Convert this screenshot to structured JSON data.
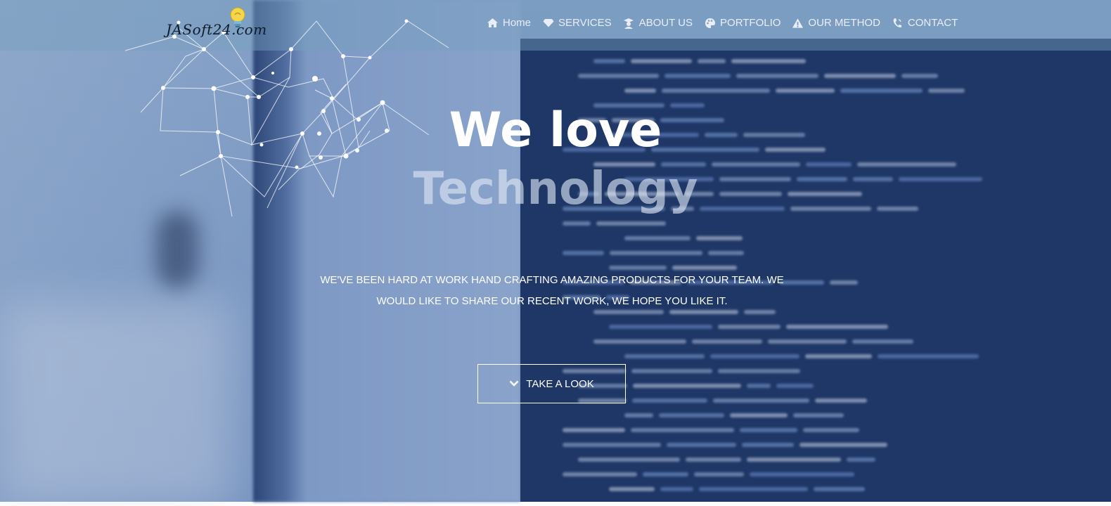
{
  "brand": {
    "logo_text": "JASoft24.com"
  },
  "nav": {
    "items": [
      {
        "label": "Home",
        "icon": "home-icon"
      },
      {
        "label": "SERVICES",
        "icon": "diamond-icon"
      },
      {
        "label": "ABOUT US",
        "icon": "graduate-icon"
      },
      {
        "label": "PORTFOLIO",
        "icon": "palette-icon"
      },
      {
        "label": "OUR METHOD",
        "icon": "triangle-icon"
      },
      {
        "label": "CONTACT",
        "icon": "phone-icon"
      }
    ]
  },
  "hero": {
    "title_line1": "We love",
    "title_line2": "Technology",
    "subtitle_line1": "WE'VE BEEN HARD AT WORK HAND CRAFTING AMAZING PRODUCTS FOR YOUR TEAM. WE",
    "subtitle_line2": "WOULD LIKE TO SHARE OUR RECENT WORK, WE HOPE YOU LIKE IT.",
    "cta_label": "TAKE A LOOK",
    "cta_icon": "chevron-down-icon"
  },
  "colors": {
    "accent": "#ffffff",
    "code_background": "#1f3766",
    "nav_text": "#e9eef6"
  }
}
